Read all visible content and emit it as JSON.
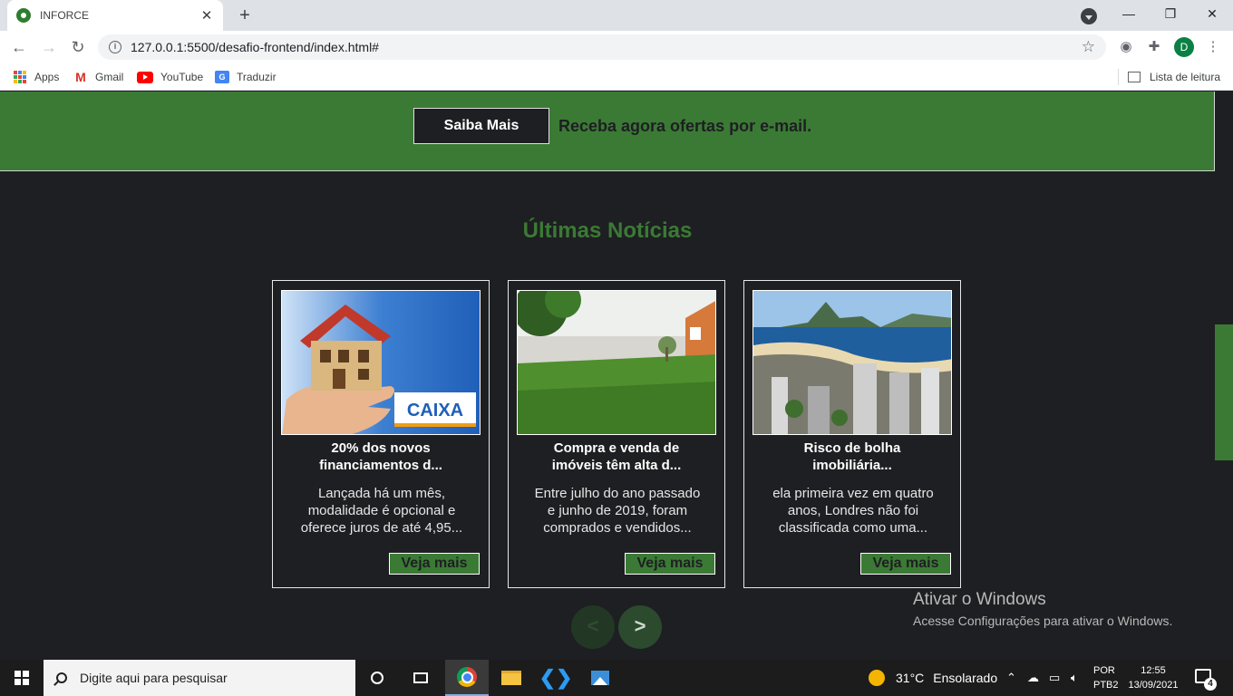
{
  "browser": {
    "tab_title": "INFORCE",
    "tab_close": "✕",
    "new_tab": "+",
    "url": "127.0.0.1:5500/desafio-frontend/index.html#",
    "profile_initial": "D",
    "window_controls": {
      "minimize": "—",
      "restore": "❐",
      "close": "✕"
    },
    "bookmarks": [
      {
        "label": "Apps",
        "icon": "apps-grid-icon"
      },
      {
        "label": "Gmail",
        "icon": "gmail-icon"
      },
      {
        "label": "YouTube",
        "icon": "youtube-icon"
      },
      {
        "label": "Traduzir",
        "icon": "google-translate-icon"
      }
    ],
    "reading_list": "Lista de leitura"
  },
  "page": {
    "promo": {
      "button_label": "Saiba Mais",
      "text": "Receba agora ofertas por e-mail."
    },
    "news": {
      "title": "Últimas Notícias",
      "cards": [
        {
          "title_line1": "20% dos novos",
          "title_line2": "financiamentos d...",
          "desc_line1": "Lançada há um mês,",
          "desc_line2": "modalidade é opcional e",
          "desc_line3": "oferece juros de até 4,95...",
          "button": "Veja mais",
          "image_text": "CAIXA"
        },
        {
          "title_line1": "Compra e venda de",
          "title_line2": "imóveis têm alta d...",
          "desc_line1": "Entre julho do ano passado",
          "desc_line2": "e junho de 2019, foram",
          "desc_line3": "comprados e vendidos...",
          "button": "Veja mais"
        },
        {
          "title_line1": "Risco de bolha",
          "title_line2": "imobiliária...",
          "desc_line1": "ela primeira vez em quatro",
          "desc_line2": "anos, Londres não foi",
          "desc_line3": "classificada como uma...",
          "button": "Veja mais"
        }
      ],
      "prev": "<",
      "next": ">"
    },
    "watermark": {
      "line1": "Ativar o Windows",
      "line2": "Acesse Configurações para ativar o Windows."
    }
  },
  "taskbar": {
    "search_placeholder": "Digite aqui para pesquisar",
    "temperature": "31°C",
    "condition": "Ensolarado",
    "lang_line1": "POR",
    "lang_line2": "PTB2",
    "time": "12:55",
    "date": "13/09/2021",
    "notification_count": "4"
  },
  "colors": {
    "accent_green": "#3b7a35",
    "page_bg": "#1e1f22"
  }
}
